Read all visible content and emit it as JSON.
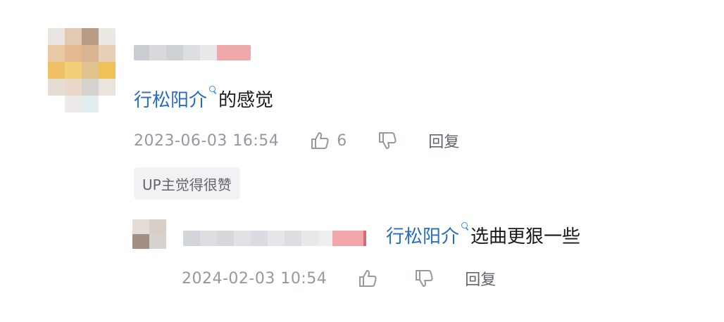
{
  "comment": {
    "mention": "行松阳介",
    "text": "的感觉",
    "timestamp": "2023-06-03 16:54",
    "like_count": "6",
    "reply_label": "回复",
    "up_badge": "UP主觉得很赞"
  },
  "reply": {
    "mention": "行松阳介",
    "text": "选曲更狠一些",
    "timestamp": "2024-02-03 10:54",
    "reply_label": "回复"
  },
  "icons": {
    "like": "thumb-up-icon",
    "dislike": "thumb-down-icon",
    "mention": "search-icon"
  },
  "colors": {
    "mention": "#2a6dbd",
    "meta": "#9499a0",
    "badge_bg": "#f1f2f3"
  }
}
